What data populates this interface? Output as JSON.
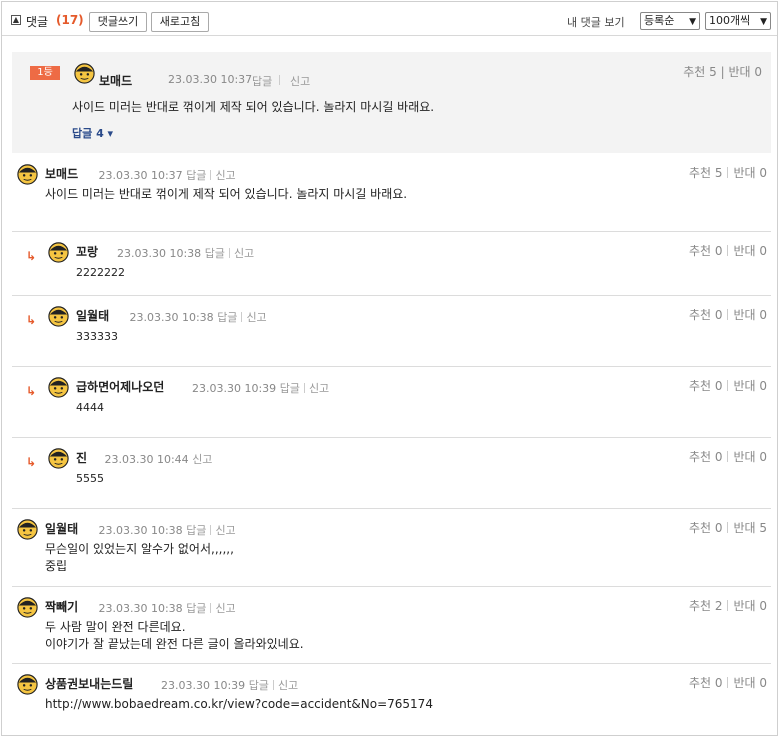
{
  "header": {
    "toggle_symbol": "▲",
    "title": "댓글",
    "count": "(17)",
    "write_label": "댓글쓰기",
    "refresh_label": "새로고침",
    "my_comments_label": "내 댓글 보기",
    "sort_value": "등록순",
    "page_size_value": "100개씩"
  },
  "best": {
    "rank_badge": "1등",
    "author": "보매드",
    "date": "23.03.30 10:37",
    "reply_label": "답글",
    "report_label": "신고",
    "votes": "추천 5 | 반대 0",
    "text": "사이드 미러는 반대로 꺾이게 제작 되어 있습니다. 놀라지 마시길 바래요.",
    "replies_toggle": "답글 4 ▾"
  },
  "comments": [
    {
      "author": "보매드",
      "date": "23.03.30 10:37",
      "reply_label": "답글",
      "report_label": "신고",
      "up": "추천 5",
      "down": "반대 0",
      "lines": [
        "사이드 미러는 반대로 꺾이게 제작 되어 있습니다. 놀라지 마시길 바래요.",
        ""
      ],
      "is_reply": false
    },
    {
      "author": "꼬랑",
      "date": "23.03.30 10:38",
      "reply_label": "답글",
      "report_label": "신고",
      "up": "추천 0",
      "down": "반대 0",
      "lines": [
        "2222222",
        ""
      ],
      "is_reply": true
    },
    {
      "author": "일월태",
      "date": "23.03.30 10:38",
      "reply_label": "답글",
      "report_label": "신고",
      "up": "추천 0",
      "down": "반대 0",
      "lines": [
        "333333",
        ""
      ],
      "is_reply": true
    },
    {
      "author": "급하면어제나오던",
      "date": "23.03.30 10:39",
      "reply_label": "답글",
      "report_label": "신고",
      "up": "추천 0",
      "down": "반대 0",
      "lines": [
        "4444",
        ""
      ],
      "is_reply": true
    },
    {
      "author": "진",
      "date": "23.03.30 10:44",
      "reply_label": "",
      "report_label": "신고",
      "up": "추천 0",
      "down": "반대 0",
      "lines": [
        "5555",
        ""
      ],
      "is_reply": true
    },
    {
      "author": "일월태",
      "date": "23.03.30 10:38",
      "reply_label": "답글",
      "report_label": "신고",
      "up": "추천 0",
      "down": "반대 5",
      "lines": [
        "무슨일이 있었는지 알수가 없어서,,,,,,",
        "중립"
      ],
      "is_reply": false
    },
    {
      "author": "짝빼기",
      "date": "23.03.30 10:38",
      "reply_label": "답글",
      "report_label": "신고",
      "up": "추천 2",
      "down": "반대 0",
      "lines": [
        "두 사람 말이 완전 다른데요.",
        "이야기가 잘 끝났는데 완전 다른 글이 올라와있네요."
      ],
      "is_reply": false
    },
    {
      "author": "상품권보내는드릴",
      "date": "23.03.30 10:39",
      "reply_label": "답글",
      "report_label": "신고",
      "up": "추천 0",
      "down": "반대 0",
      "lines": [
        "http://www.bobaedream.co.kr/view?code=accident&No=765174",
        ""
      ],
      "is_reply": false
    }
  ],
  "colors": {
    "accent": "#e55a2b",
    "badge": "#ee6b45",
    "best_bg": "#f3f3f3"
  }
}
